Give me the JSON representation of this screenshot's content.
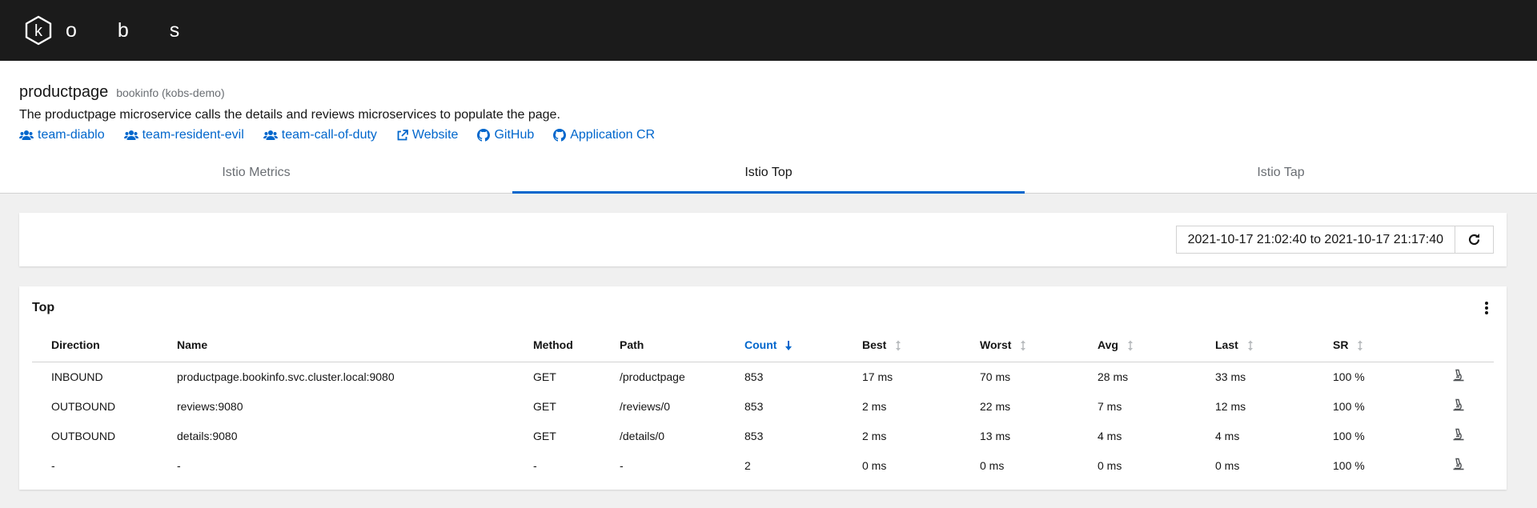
{
  "brand": {
    "logo_letter": "k",
    "name": "o b s"
  },
  "app": {
    "name": "productpage",
    "subtitle": "bookinfo (kobs-demo)",
    "description": "The productpage microservice calls the details and reviews microservices to populate the page.",
    "links": [
      {
        "label": "team-diablo",
        "icon": "users-icon"
      },
      {
        "label": "team-resident-evil",
        "icon": "users-icon"
      },
      {
        "label": "team-call-of-duty",
        "icon": "users-icon"
      },
      {
        "label": "Website",
        "icon": "external-link-icon"
      },
      {
        "label": "GitHub",
        "icon": "github-icon"
      },
      {
        "label": "Application CR",
        "icon": "github-icon"
      }
    ]
  },
  "tabs": [
    {
      "label": "Istio Metrics",
      "active": false
    },
    {
      "label": "Istio Top",
      "active": true
    },
    {
      "label": "Istio Tap",
      "active": false
    }
  ],
  "toolbar": {
    "time_range": "2021-10-17 21:02:40 to 2021-10-17 21:17:40",
    "refresh_icon": "refresh-icon"
  },
  "top": {
    "title": "Top",
    "columns": [
      "Direction",
      "Name",
      "Method",
      "Path",
      "Count",
      "Best",
      "Worst",
      "Avg",
      "Last",
      "SR"
    ],
    "sorted_column": "Count",
    "rows": [
      [
        "INBOUND",
        "productpage.bookinfo.svc.cluster.local:9080",
        "GET",
        "/productpage",
        "853",
        "17 ms",
        "70 ms",
        "28 ms",
        "33 ms",
        "100 %"
      ],
      [
        "OUTBOUND",
        "reviews:9080",
        "GET",
        "/reviews/0",
        "853",
        "2 ms",
        "22 ms",
        "7 ms",
        "12 ms",
        "100 %"
      ],
      [
        "OUTBOUND",
        "details:9080",
        "GET",
        "/details/0",
        "853",
        "2 ms",
        "13 ms",
        "4 ms",
        "4 ms",
        "100 %"
      ],
      [
        "-",
        "-",
        "-",
        "-",
        "2",
        "0 ms",
        "0 ms",
        "0 ms",
        "0 ms",
        "100 %"
      ]
    ]
  },
  "colors": {
    "accent": "#0066cc",
    "masthead": "#1b1b1b"
  }
}
